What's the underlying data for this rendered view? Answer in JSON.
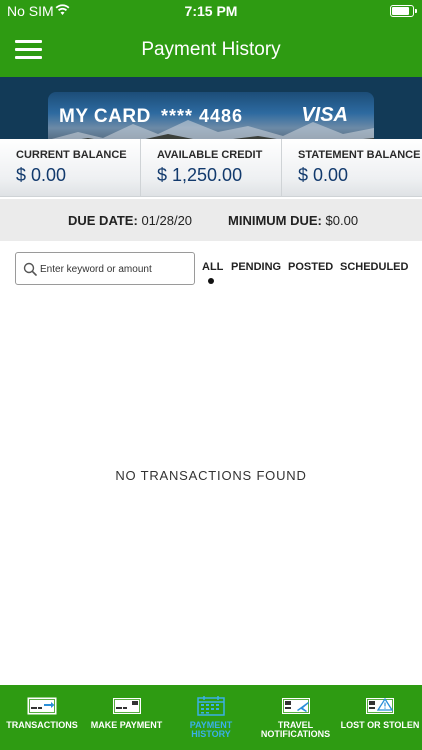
{
  "status_bar": {
    "carrier": "No SIM",
    "time": "7:15 PM"
  },
  "header": {
    "title": "Payment History"
  },
  "card": {
    "name": "MY CARD",
    "masked_number": "**** 4486",
    "network": "VISA"
  },
  "balances": [
    {
      "label": "CURRENT BALANCE",
      "value": "$ 0.00"
    },
    {
      "label": "AVAILABLE CREDIT",
      "value": "$ 1,250.00"
    },
    {
      "label": "STATEMENT BALANCE",
      "value": "$ 0.00"
    }
  ],
  "due": {
    "due_date_label": "DUE DATE:",
    "due_date": "01/28/20",
    "min_due_label": "MINIMUM DUE:",
    "min_due": "$0.00"
  },
  "search": {
    "placeholder": "Enter keyword or amount",
    "value": ""
  },
  "filters": {
    "all": "ALL",
    "pending": "PENDING",
    "posted": "POSTED",
    "scheduled": "SCHEDULED",
    "selected": "ALL"
  },
  "empty_message": "NO TRANSACTIONS FOUND",
  "tabbar": {
    "transactions": "TRANSACTIONS",
    "make_payment": "MAKE PAYMENT",
    "payment_history": "PAYMENT HISTORY",
    "travel_notifications": "TRAVEL NOTIFICATIONS",
    "lost_or_stolen": "LOST OR STOLEN",
    "active": "PAYMENT HISTORY"
  },
  "colors": {
    "brand_green": "#2e9b12",
    "navy": "#123a57",
    "active_tab": "#3ab0e8",
    "amount_blue": "#123a6d"
  }
}
